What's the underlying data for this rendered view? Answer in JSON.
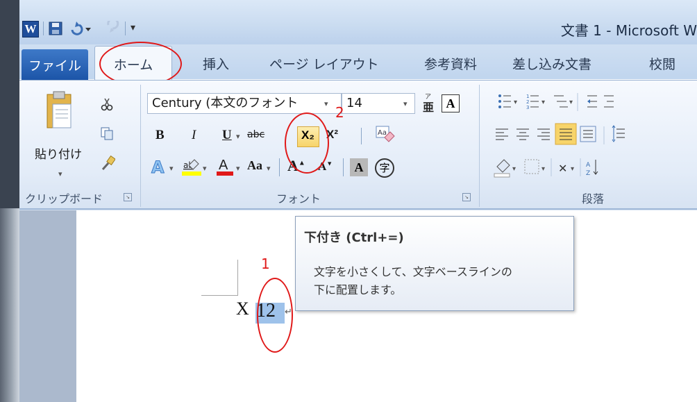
{
  "window": {
    "title": "文書 1 - Microsoft W"
  },
  "qat": {
    "logo": "W",
    "save_icon": "save-icon",
    "undo_icon": "undo-icon",
    "redo_icon": "redo-icon"
  },
  "tabs": {
    "file": "ファイル",
    "home": "ホーム",
    "insert": "挿入",
    "page_layout": "ページ レイアウト",
    "references": "参考資料",
    "mailings": "差し込み文書",
    "review": "校閲"
  },
  "clipboard": {
    "paste": "貼り付け",
    "group_label": "クリップボード"
  },
  "font": {
    "name": "Century (本文のフォント",
    "size": "14",
    "group_label": "フォント",
    "bold": "B",
    "italic": "I",
    "underline": "U",
    "strike": "abc",
    "subscript": "X₂",
    "superscript": "X²",
    "phonetic": "A",
    "case": "Aa",
    "grow": "A",
    "shrink": "A",
    "char_shading": "A",
    "enclose": "字"
  },
  "paragraph": {
    "group_label": "段落"
  },
  "annotations": {
    "label_1": "1",
    "label_2": "2"
  },
  "document": {
    "base_text": "X",
    "sub_text": "12",
    "para_mark": "↵"
  },
  "tooltip": {
    "title": "下付き (Ctrl+=)",
    "line1": "文字を小さくして、文字ベースラインの",
    "line2": "下に配置します。"
  },
  "colors": {
    "accent_red": "#e01919",
    "highlight": "#f7d46a",
    "file_tab": "#1c55a8"
  }
}
